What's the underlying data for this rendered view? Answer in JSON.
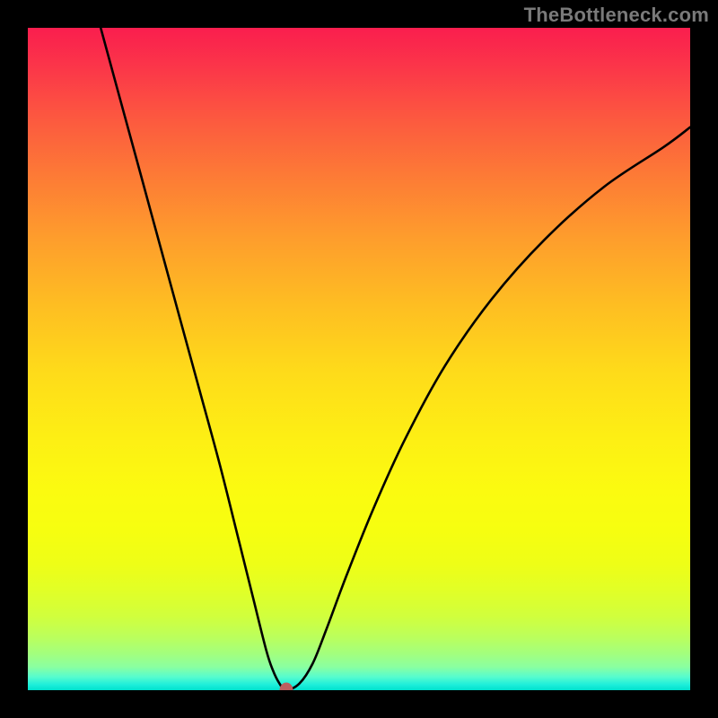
{
  "attribution": "TheBottleneck.com",
  "colors": {
    "frame_bg": "#000000",
    "curve": "#000000",
    "dot": "#bd5e5e",
    "attribution_text": "#7a7a7a"
  },
  "chart_data": {
    "type": "line",
    "title": "",
    "xlabel": "",
    "ylabel": "",
    "xlim": [
      0,
      100
    ],
    "ylim": [
      0,
      100
    ],
    "grid": false,
    "legend": false,
    "background": "vertical-gradient red-yellow-green (bottleneck heatmap)",
    "series": [
      {
        "name": "bottleneck-curve",
        "x": [
          11,
          14,
          17,
          20,
          23,
          26,
          29,
          32,
          34,
          36,
          37,
          38,
          39,
          41,
          43,
          45,
          48,
          52,
          57,
          63,
          70,
          78,
          87,
          96,
          100
        ],
        "y": [
          100,
          89,
          78,
          67,
          56,
          45,
          34,
          22,
          14,
          6,
          3,
          1,
          0,
          1,
          4,
          9,
          17,
          27,
          38,
          49,
          59,
          68,
          76,
          82,
          85
        ]
      }
    ],
    "annotations": [
      {
        "name": "minimum-point",
        "x": 39,
        "y": 0,
        "marker": "dot",
        "color": "#bd5e5e"
      }
    ]
  }
}
